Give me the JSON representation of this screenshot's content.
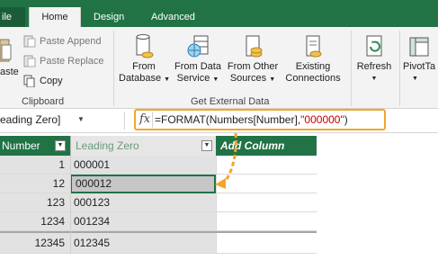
{
  "ribbon_tabs": [
    {
      "label": "ile"
    },
    {
      "label": "Home"
    },
    {
      "label": "Design"
    },
    {
      "label": "Advanced"
    }
  ],
  "clipboard": {
    "paste_label": "aste",
    "paste_append": "Paste Append",
    "paste_replace": "Paste Replace",
    "copy": "Copy",
    "group_label": "Clipboard"
  },
  "external_data": {
    "from_database": [
      "From",
      "Database"
    ],
    "from_data_service": [
      "From Data",
      "Service"
    ],
    "from_other_sources": [
      "From Other",
      "Sources"
    ],
    "existing_connections": [
      "Existing",
      "Connections"
    ],
    "group_label": "Get External Data"
  },
  "refresh_label": "Refresh",
  "pivot_label": "PivotTa",
  "formula_bar": {
    "name_box": "eading Zero]",
    "fx": "fx",
    "formula": {
      "prefix": "=FORMAT(",
      "arg": "Numbers[Number]",
      "comma": ",",
      "literal": "\"000000\"",
      "suffix": ")"
    }
  },
  "grid": {
    "headers": {
      "number": "Number",
      "leading_zero": "Leading Zero",
      "add_column": "Add Column"
    },
    "rows": [
      {
        "number": "1",
        "leading_zero": "000001"
      },
      {
        "number": "12",
        "leading_zero": "000012"
      },
      {
        "number": "123",
        "leading_zero": "000123"
      },
      {
        "number": "1234",
        "leading_zero": "001234"
      },
      {
        "number": "12345",
        "leading_zero": "012345"
      }
    ]
  },
  "colors": {
    "accent": "#217346",
    "highlight": "#f2a628",
    "string_literal": "#c00000"
  }
}
